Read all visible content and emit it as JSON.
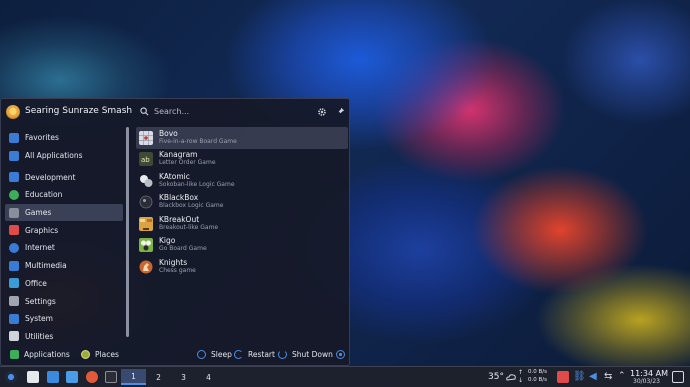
{
  "launcher": {
    "user_name": "Searing Sunraze Smash",
    "search_placeholder": "Search...",
    "categories": [
      {
        "label": "Favorites",
        "icon": "favorites-icon",
        "color": "#3a7bd5"
      },
      {
        "label": "All Applications",
        "icon": "all-apps-icon",
        "color": "#3a7bd5"
      },
      {
        "label": "Development",
        "icon": "development-icon",
        "color": "#3a7bd5"
      },
      {
        "label": "Education",
        "icon": "education-icon",
        "color": "#3cae5a"
      },
      {
        "label": "Games",
        "icon": "games-icon",
        "color": "#8a8e9a"
      },
      {
        "label": "Graphics",
        "icon": "graphics-icon",
        "color": "#e04a4a"
      },
      {
        "label": "Internet",
        "icon": "internet-icon",
        "color": "#3a7bd5"
      },
      {
        "label": "Multimedia",
        "icon": "multimedia-icon",
        "color": "#3a7bd5"
      },
      {
        "label": "Office",
        "icon": "office-icon",
        "color": "#3a9bd5"
      },
      {
        "label": "Settings",
        "icon": "settings-icon",
        "color": "#a0a4b0"
      },
      {
        "label": "System",
        "icon": "system-icon",
        "color": "#3a7bd5"
      },
      {
        "label": "Utilities",
        "icon": "utilities-icon",
        "color": "#d0d3da"
      }
    ],
    "selected_category": "Games",
    "apps": [
      {
        "name": "Bovo",
        "desc": "Five-in-a-row Board Game",
        "icon": "bovo-icon",
        "color": "#c8ccd6"
      },
      {
        "name": "Kanagram",
        "desc": "Letter Order Game",
        "icon": "kanagram-icon",
        "color": "#4a5a3a"
      },
      {
        "name": "KAtomic",
        "desc": "Sokoban-like Logic Game",
        "icon": "katomic-icon",
        "color": "#e8eaee"
      },
      {
        "name": "KBlackBox",
        "desc": "Blackbox Logic Game",
        "icon": "kblackbox-icon",
        "color": "#2a2d35"
      },
      {
        "name": "KBreakOut",
        "desc": "Breakout-like Game",
        "icon": "kbreakout-icon",
        "color": "#d9a441"
      },
      {
        "name": "Kigo",
        "desc": "Go Board Game",
        "icon": "kigo-icon",
        "color": "#7cb342"
      },
      {
        "name": "Knights",
        "desc": "Chess game",
        "icon": "knights-icon",
        "color": "#c8662e"
      }
    ],
    "footer": {
      "applications": "Applications",
      "places": "Places",
      "sleep": "Sleep",
      "restart": "Restart",
      "shutdown": "Shut Down"
    }
  },
  "taskbar": {
    "desktops": [
      "1",
      "2",
      "3",
      "4"
    ],
    "active_desktop": "1",
    "temperature": "35°",
    "net_up": "0.0 B/s",
    "net_down": "0.0 B/s",
    "time": "11:34 AM",
    "date": "30/03/23"
  }
}
